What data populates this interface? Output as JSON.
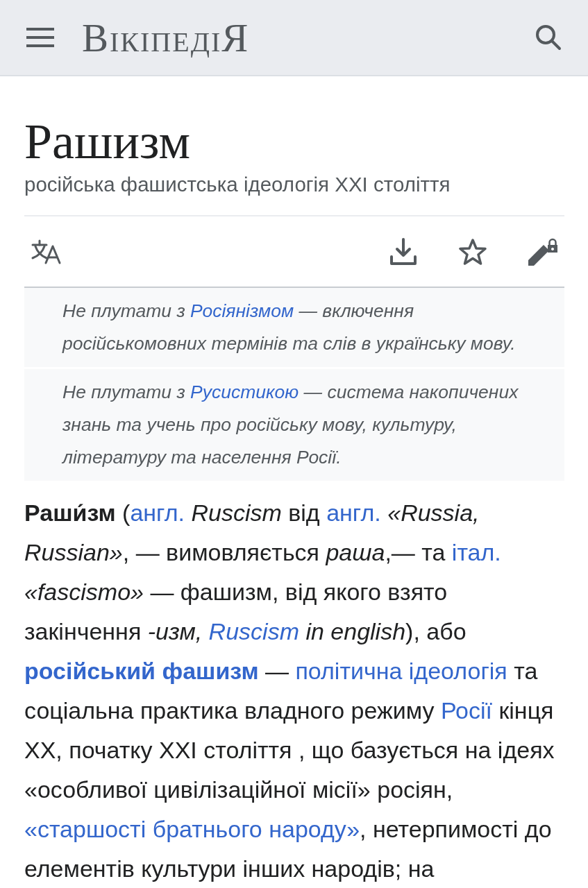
{
  "header": {
    "wordmark": "ВікіпедіЯ"
  },
  "page": {
    "title": "Рашизм",
    "description": "російська фашистська ідеологія XXI століття"
  },
  "hatnotes": [
    {
      "before": "Не плутати з ",
      "link": "Росіянізмом",
      "after": " — включення російськомовних термінів та слів в українську мову."
    },
    {
      "before": "Не плутати з ",
      "link": "Русистикою",
      "after": " — система накопичених знань та учень про російську мову, культуру, літературу та населення Росії."
    }
  ],
  "paragraph": [
    {
      "kind": "bold",
      "text": "Раши́зм"
    },
    {
      "kind": "plain",
      "text": " ("
    },
    {
      "kind": "link",
      "text": "англ."
    },
    {
      "kind": "italic",
      "text": " Ruscism"
    },
    {
      "kind": "plain",
      "text": " від "
    },
    {
      "kind": "link",
      "text": "англ."
    },
    {
      "kind": "italic",
      "text": " «Russia, Russian»"
    },
    {
      "kind": "plain",
      "text": ", — вимовляється "
    },
    {
      "kind": "italic",
      "text": "раша"
    },
    {
      "kind": "plain",
      "text": ",— та "
    },
    {
      "kind": "link",
      "text": "італ."
    },
    {
      "kind": "italic",
      "text": " «fascismo»"
    },
    {
      "kind": "plain",
      "text": " — фашизм, від якого взято закінчення "
    },
    {
      "kind": "italic",
      "text": "-изм, "
    },
    {
      "kind": "italic_link",
      "text": "Ruscism"
    },
    {
      "kind": "italic",
      "text": " in english"
    },
    {
      "kind": "plain",
      "text": "), або "
    },
    {
      "kind": "bold_link",
      "text": "російський фашизм"
    },
    {
      "kind": "plain",
      "text": " — "
    },
    {
      "kind": "link",
      "text": "політична ідеологія"
    },
    {
      "kind": "plain",
      "text": " та соціальна практика владного режиму "
    },
    {
      "kind": "link",
      "text": "Росії"
    },
    {
      "kind": "plain",
      "text": " кінця XX, початку XXI століття , що базується на ідеях «особливої цивілізаційної місії» росіян, "
    },
    {
      "kind": "link",
      "text": "«старшості братнього народу»"
    },
    {
      "kind": "plain",
      "text": ", нетерпимості до елементів культури інших народів; на"
    }
  ]
}
